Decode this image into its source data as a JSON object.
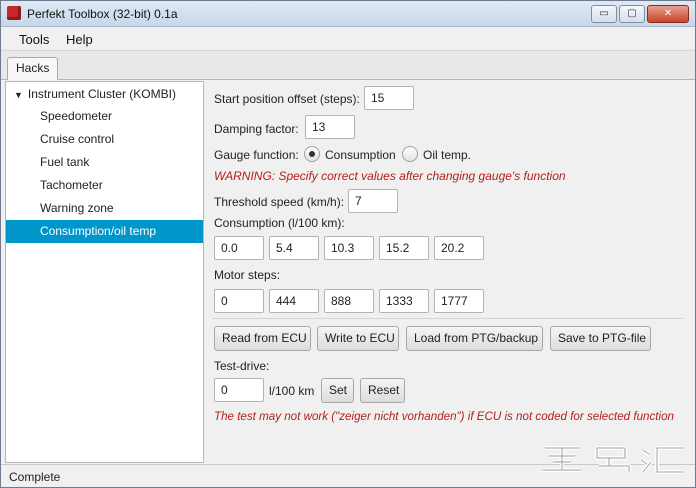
{
  "window": {
    "title": "Perfekt Toolbox (32-bit) 0.1a",
    "app_icon": "toolbox-icon",
    "minimize_glyph": "▭",
    "maximize_glyph": "▢",
    "close_glyph": "✕"
  },
  "menu": {
    "items": [
      "Tools",
      "Help"
    ]
  },
  "tabs": {
    "active": "Hacks"
  },
  "tree": {
    "root": "Instrument Cluster (KOMBI)",
    "items": [
      "Speedometer",
      "Cruise control",
      "Fuel tank",
      "Tachometer",
      "Warning zone",
      "Consumption/oil temp"
    ],
    "selected_index": 5
  },
  "form": {
    "start_offset_label": "Start position offset (steps):",
    "start_offset_value": "15",
    "damping_label": "Damping factor:",
    "damping_value": "13",
    "gauge_function_label": "Gauge function:",
    "gauge_options": [
      {
        "label": "Consumption",
        "selected": true
      },
      {
        "label": "Oil temp.",
        "selected": false
      }
    ],
    "warning": "WARNING: Specify correct values after changing gauge's function",
    "threshold_label": "Threshold speed (km/h):",
    "threshold_value": "7",
    "consumption_label": "Consumption (l/100 km):",
    "consumption_values": [
      "0.0",
      "5.4",
      "10.3",
      "15.2",
      "20.2"
    ],
    "motor_steps_label": "Motor steps:",
    "motor_steps_values": [
      "0",
      "444",
      "888",
      "1333",
      "1777"
    ],
    "buttons": {
      "read": "Read from ECU",
      "write": "Write to ECU",
      "load": "Load from PTG/backup",
      "save": "Save to PTG-file"
    },
    "testdrive_label": "Test-drive:",
    "testdrive_value": "0",
    "testdrive_unit": "l/100 km",
    "set_label": "Set",
    "reset_label": "Reset",
    "test_warning": "The test may not work (\"zeiger nicht vorhanden\") if ECU is not coded for selected function"
  },
  "status": {
    "text": "Complete"
  },
  "colors": {
    "selection": "#0096c9",
    "warning": "#b41e1e"
  }
}
